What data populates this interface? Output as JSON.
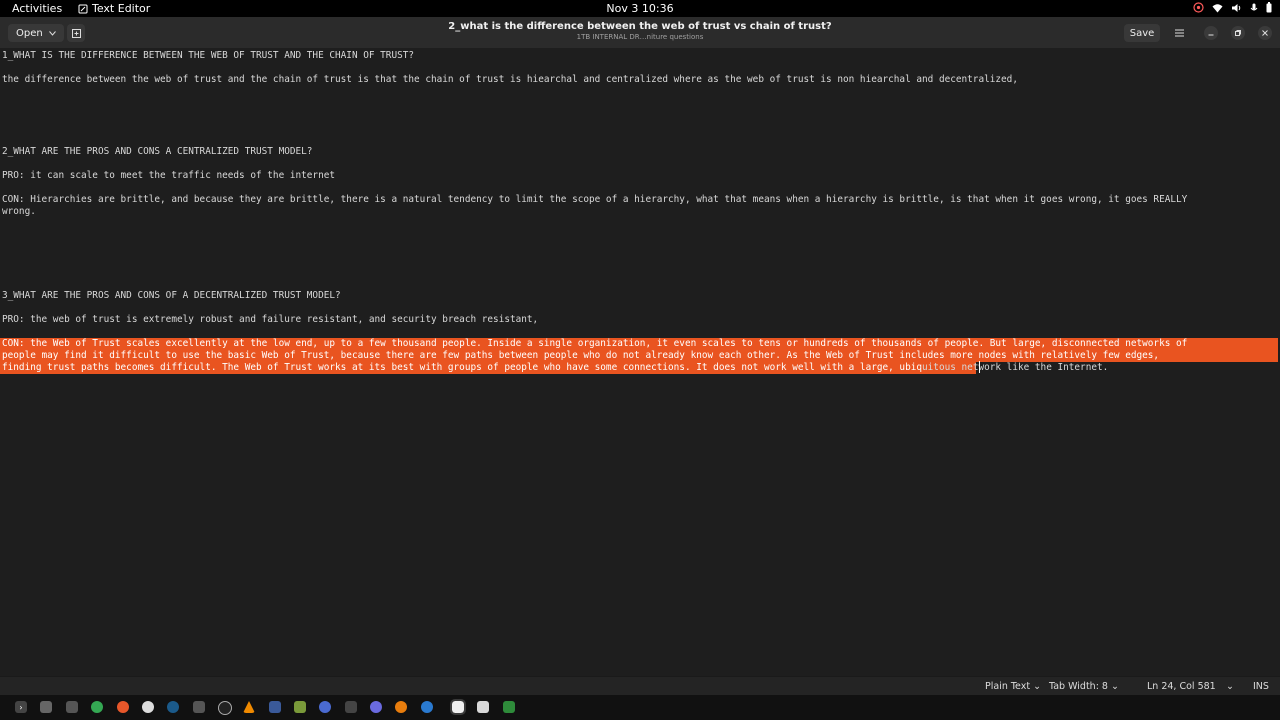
{
  "topbar": {
    "activities": "Activities",
    "app_name": "Text Editor",
    "clock": "Nov 3  10:36",
    "tray_icons": [
      "chrome-status-icon",
      "wifi-icon",
      "volume-icon",
      "microphone-icon",
      "battery-icon"
    ]
  },
  "header": {
    "open_label": "Open",
    "title": "2_what is the difference between the web of trust vs chain of trust?",
    "subtitle": "1TB INTERNAL DR…niture questions",
    "save_label": "Save"
  },
  "editor": {
    "lines": [
      "1_WHAT IS THE DIFFERENCE BETWEEN THE WEB OF TRUST AND THE CHAIN OF TRUST?",
      "the difference between the web of trust and the chain of trust is that the chain of trust is hiearchal and centralized where as the web of trust is non hiearchal and decentralized,",
      "2_WHAT ARE THE PROS AND CONS A CENTRALIZED TRUST MODEL?",
      "PRO: it can scale to meet the traffic needs of the internet",
      "CON: Hierarchies are brittle, and because they are brittle, there is a natural tendency to limit the scope of a hierarchy, what that means when a hierarchy is brittle, is that when it goes wrong, it goes REALLY",
      "wrong.",
      "3_WHAT ARE THE PROS AND CONS OF A DECENTRALIZED TRUST MODEL?",
      "PRO: the web of trust is extremely robust and failure resistant, and security breach resistant,"
    ],
    "selected_lines": [
      "CON: the Web of Trust scales excellently at the low end, up to a few thousand people. Inside a single organization, it even scales to tens or hundreds of thousands of people. But large, disconnected networks of",
      "people may find it difficult to use the basic Web of Trust, because there are few paths between people who do not already know each other. As the Web of Trust includes more nodes with relatively few edges,",
      "finding trust paths becomes difficult. The Web of Trust works at its best with groups of people who have some connections. It does not work well with a large, ubiq"
    ],
    "unselected_tail": "uitous network like the Internet."
  },
  "status": {
    "language": "Plain Text",
    "tab_width": "Tab Width: 8",
    "position": "Ln 24, Col 581",
    "mode": "INS"
  },
  "dock": {
    "icons": [
      "terminal-icon",
      "files-icon",
      "archive-icon",
      "chrome-icon",
      "firefox-icon",
      "app-icon",
      "steam-icon",
      "game-icon",
      "settings-icon",
      "vlc-icon",
      "bluetooth-icon",
      "tool-icon",
      "browser-icon",
      "keyboard-icon",
      "chat-icon",
      "blender-icon",
      "network-icon",
      "text-editor-icon",
      "document-icon",
      "spreadsheet-icon"
    ],
    "colors": {
      "accent": "#e95420",
      "bg": "#111111"
    }
  }
}
